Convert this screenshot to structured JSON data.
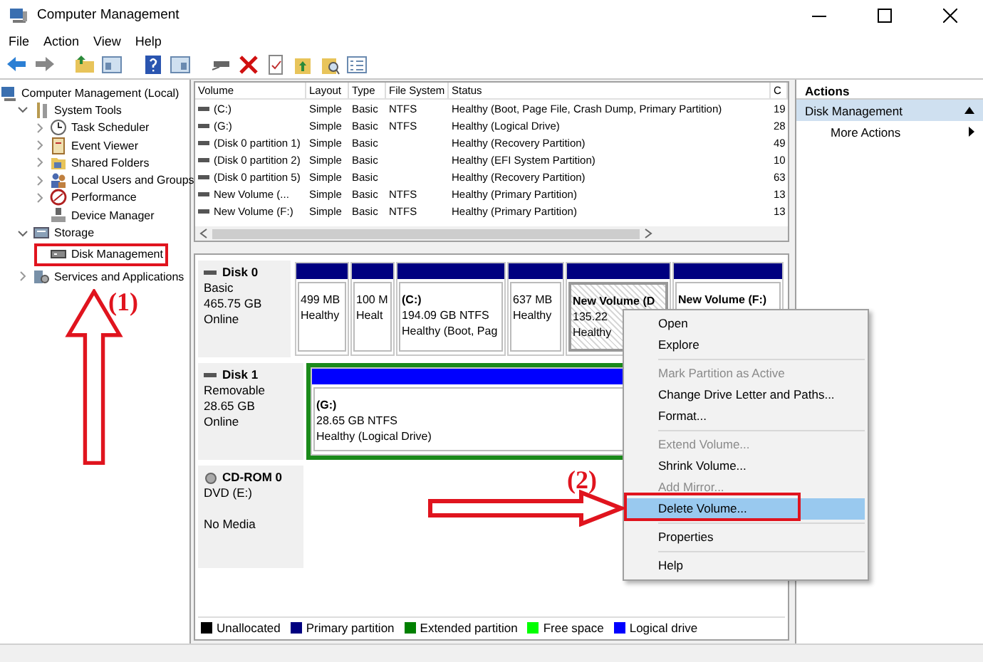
{
  "window": {
    "title": "Computer Management"
  },
  "menu_bar": [
    "File",
    "Action",
    "View",
    "Help"
  ],
  "tree": [
    {
      "label": "Computer Management (Local)",
      "children": [
        {
          "label": "System Tools",
          "expanded": true,
          "children": [
            {
              "label": "Task Scheduler",
              "expanded": false
            },
            {
              "label": "Event Viewer",
              "expanded": false
            },
            {
              "label": "Shared Folders",
              "expanded": false
            },
            {
              "label": "Local Users and Groups",
              "expanded": false
            },
            {
              "label": "Performance",
              "expanded": false
            },
            {
              "label": "Device Manager"
            }
          ]
        },
        {
          "label": "Storage",
          "expanded": true,
          "children": [
            {
              "label": "Disk Management"
            }
          ]
        },
        {
          "label": "Services and Applications",
          "expanded": false
        }
      ]
    }
  ],
  "volume_table": {
    "columns": [
      "Volume",
      "Layout",
      "Type",
      "File System",
      "Status",
      "C"
    ],
    "rows": [
      [
        "(C:)",
        "Simple",
        "Basic",
        "NTFS",
        "Healthy (Boot, Page File, Crash Dump, Primary Partition)",
        "19"
      ],
      [
        "(G:)",
        "Simple",
        "Basic",
        "NTFS",
        "Healthy (Logical Drive)",
        "28"
      ],
      [
        "(Disk 0 partition 1)",
        "Simple",
        "Basic",
        "",
        "Healthy (Recovery Partition)",
        "49"
      ],
      [
        "(Disk 0 partition 2)",
        "Simple",
        "Basic",
        "",
        "Healthy (EFI System Partition)",
        "10"
      ],
      [
        "(Disk 0 partition 5)",
        "Simple",
        "Basic",
        "",
        "Healthy (Recovery Partition)",
        "63"
      ],
      [
        "New Volume (...",
        "Simple",
        "Basic",
        "NTFS",
        "Healthy (Primary Partition)",
        "13"
      ],
      [
        "New Volume (F:)",
        "Simple",
        "Basic",
        "NTFS",
        "Healthy (Primary Partition)",
        "13"
      ]
    ]
  },
  "disks": [
    {
      "name": "Disk 0",
      "lines": [
        "Basic",
        "465.75 GB",
        "Online"
      ],
      "partitions": [
        {
          "kind": "primary",
          "selected": false,
          "lines": [
            "499 MB",
            "Healthy"
          ]
        },
        {
          "kind": "primary",
          "selected": false,
          "lines": [
            "100 M",
            "Healt"
          ]
        },
        {
          "kind": "primary",
          "selected": false,
          "title": "(C:)",
          "lines": [
            "194.09 GB NTFS",
            "Healthy (Boot, Pag"
          ]
        },
        {
          "kind": "primary",
          "selected": false,
          "lines": [
            "637 MB",
            "Healthy"
          ]
        },
        {
          "kind": "primary",
          "selected": true,
          "title": "New Volume  (D",
          "lines": [
            "135.22",
            "Healthy"
          ]
        },
        {
          "kind": "primary",
          "selected": false,
          "title": "New Volume  (F:)"
        }
      ]
    },
    {
      "name": "Disk 1",
      "lines": [
        "Removable",
        "28.65 GB",
        "Online"
      ],
      "partitions": [
        {
          "kind": "logical",
          "selected": false,
          "title": "(G:)",
          "lines": [
            "28.65 GB NTFS",
            "Healthy (Logical Drive)"
          ]
        }
      ]
    },
    {
      "name": "CD-ROM 0",
      "lines": [
        "DVD (E:)",
        "No Media"
      ]
    }
  ],
  "legend": [
    {
      "label": "Unallocated",
      "color": "#000000"
    },
    {
      "label": "Primary partition",
      "color": "#000080"
    },
    {
      "label": "Extended partition",
      "color": "#008000"
    },
    {
      "label": "Free space",
      "color": "#00ff00"
    },
    {
      "label": "Logical drive",
      "color": "#0000ff"
    }
  ],
  "actions": {
    "title": "Actions",
    "section": "Disk Management",
    "items": [
      "More Actions"
    ]
  },
  "context_menu": [
    [
      {
        "label": "Open",
        "disabled": false,
        "selected": false
      },
      {
        "label": "Explore",
        "disabled": false,
        "selected": false
      }
    ],
    [
      {
        "label": "Mark Partition as Active",
        "disabled": true,
        "selected": false
      },
      {
        "label": "Change Drive Letter and Paths...",
        "disabled": false,
        "selected": false
      },
      {
        "label": "Format...",
        "disabled": false,
        "selected": false
      }
    ],
    [
      {
        "label": "Extend Volume...",
        "disabled": true,
        "selected": false
      },
      {
        "label": "Shrink Volume...",
        "disabled": false,
        "selected": false
      },
      {
        "label": "Add Mirror...",
        "disabled": true,
        "selected": false
      },
      {
        "label": "Delete Volume...",
        "disabled": false,
        "selected": true
      }
    ],
    [
      {
        "label": "Properties",
        "disabled": false,
        "selected": false
      }
    ],
    [
      {
        "label": "Help",
        "disabled": false,
        "selected": false
      }
    ]
  ],
  "annotations": [
    "(1)",
    "(2)"
  ]
}
